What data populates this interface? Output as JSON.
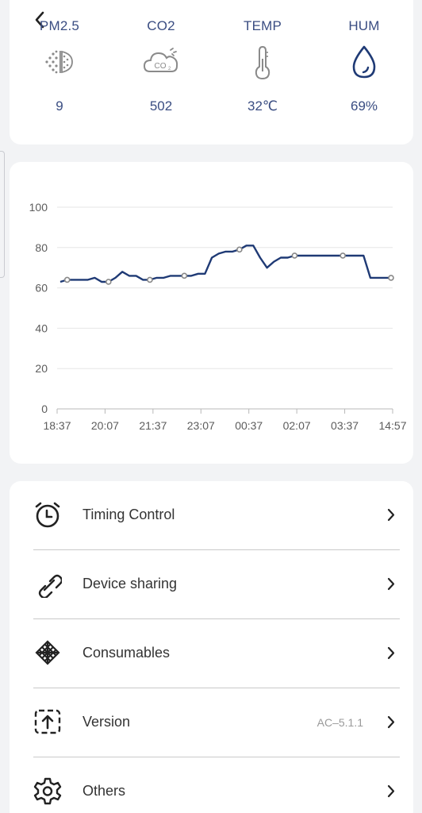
{
  "sensors": [
    {
      "label": "PM2.5",
      "value": "9",
      "icon": "pm25-icon"
    },
    {
      "label": "CO2",
      "value": "502",
      "icon": "co2-cloud-icon"
    },
    {
      "label": "TEMP",
      "value": "32℃",
      "icon": "thermometer-icon"
    },
    {
      "label": "HUM",
      "value": "69%",
      "icon": "water-drop-icon"
    }
  ],
  "chart_data": {
    "type": "line",
    "title": "",
    "xlabel": "",
    "ylabel": "",
    "ylim": [
      0,
      100
    ],
    "y_ticks": [
      0,
      20,
      40,
      60,
      80,
      100
    ],
    "x_tick_labels": [
      "18:37",
      "20:07",
      "21:37",
      "23:07",
      "00:37",
      "02:07",
      "03:37",
      "14:57"
    ],
    "grid": true,
    "color": "#1f3a75",
    "series": [
      {
        "values": [
          63,
          64,
          64,
          64,
          64,
          65,
          63,
          63,
          65,
          68,
          66,
          66,
          64,
          64,
          65,
          65,
          66,
          66,
          66,
          66,
          67,
          67,
          75,
          77,
          78,
          78,
          79,
          81,
          81,
          75,
          70,
          73,
          75,
          75,
          76,
          76,
          76,
          76,
          76,
          76,
          76,
          76,
          76,
          76,
          76,
          65,
          65,
          65,
          65
        ],
        "markers": [
          1,
          7,
          13,
          18,
          26,
          34,
          41,
          48
        ]
      }
    ]
  },
  "menu": [
    {
      "label": "Timing Control",
      "value": "",
      "icon": "alarm-clock-icon",
      "name": "menu-timing-control"
    },
    {
      "label": "Device sharing",
      "value": "",
      "icon": "link-icon",
      "name": "menu-device-sharing"
    },
    {
      "label": "Consumables",
      "value": "",
      "icon": "filter-mesh-icon",
      "name": "menu-consumables"
    },
    {
      "label": "Version",
      "value": "AC–5.1.1",
      "icon": "upload-version-icon",
      "name": "menu-version"
    },
    {
      "label": "Others",
      "value": "",
      "icon": "gear-icon",
      "name": "menu-others"
    }
  ]
}
